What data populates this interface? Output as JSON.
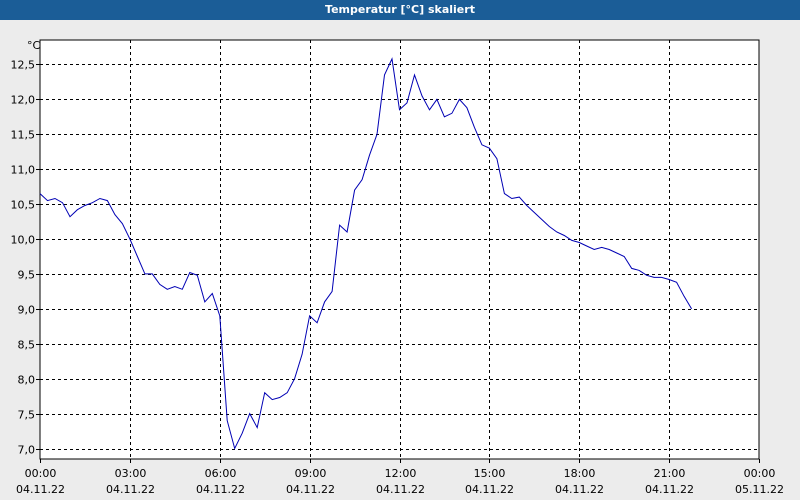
{
  "window": {
    "title": "Temperatur [°C] skaliert"
  },
  "chart_data": {
    "type": "line",
    "title": "Temperatur [°C] skaliert",
    "ylabel": "°C",
    "xlabel": "",
    "ylim": [
      6.85,
      12.85
    ],
    "xlim_hours": [
      0,
      24
    ],
    "grid": true,
    "y_ticks": [
      "7,0",
      "7,5",
      "8,0",
      "8,5",
      "9,0",
      "9,5",
      "10,0",
      "10,5",
      "11,0",
      "11,5",
      "12,0",
      "12,5"
    ],
    "x_ticks": [
      {
        "time": "00:00",
        "date": "04.11.22"
      },
      {
        "time": "03:00",
        "date": "04.11.22"
      },
      {
        "time": "06:00",
        "date": "04.11.22"
      },
      {
        "time": "09:00",
        "date": "04.11.22"
      },
      {
        "time": "12:00",
        "date": "04.11.22"
      },
      {
        "time": "15:00",
        "date": "04.11.22"
      },
      {
        "time": "18:00",
        "date": "04.11.22"
      },
      {
        "time": "21:00",
        "date": "04.11.22"
      },
      {
        "time": "00:00",
        "date": "05.11.22"
      }
    ],
    "series": [
      {
        "color": "#0000b4",
        "x_hours": [
          0.0,
          0.25,
          0.5,
          0.75,
          1.0,
          1.25,
          1.5,
          1.75,
          2.0,
          2.25,
          2.5,
          2.75,
          3.0,
          3.25,
          3.5,
          3.75,
          4.0,
          4.25,
          4.5,
          4.75,
          5.0,
          5.25,
          5.5,
          5.75,
          6.0,
          6.25,
          6.5,
          6.75,
          7.0,
          7.25,
          7.5,
          7.75,
          8.0,
          8.25,
          8.5,
          8.75,
          9.0,
          9.25,
          9.5,
          9.75,
          10.0,
          10.25,
          10.5,
          10.75,
          11.0,
          11.25,
          11.5,
          11.75,
          12.0,
          12.25,
          12.5,
          12.75,
          13.0,
          13.25,
          13.5,
          13.75,
          14.0,
          14.25,
          14.5,
          14.75,
          15.0,
          15.25,
          15.5,
          15.75,
          16.0,
          16.25,
          16.5,
          16.75,
          17.0,
          17.25,
          17.5,
          17.75,
          18.0,
          18.25,
          18.5,
          18.75,
          19.0,
          19.25,
          19.5,
          19.75,
          20.0,
          20.25,
          20.5,
          20.75,
          21.0,
          21.25,
          21.5,
          21.75,
          22.0,
          22.25,
          22.5,
          22.75,
          23.0,
          23.25,
          23.5,
          23.75
        ],
        "values": [
          10.65,
          10.55,
          10.58,
          10.52,
          10.32,
          10.42,
          10.48,
          10.52,
          10.58,
          10.55,
          10.35,
          10.22,
          10.0,
          9.75,
          9.5,
          9.5,
          9.35,
          9.28,
          9.32,
          9.28,
          9.52,
          9.48,
          9.1,
          9.22,
          8.9,
          7.4,
          7.0,
          7.22,
          7.5,
          7.3,
          7.8,
          7.7,
          7.73,
          7.8,
          8.0,
          8.35,
          8.9,
          8.8,
          9.1,
          9.25,
          10.2,
          10.1,
          10.7,
          10.85,
          11.2,
          11.5,
          12.35,
          12.58,
          11.85,
          11.95,
          12.35,
          12.05,
          11.85,
          12.0,
          11.75,
          11.8,
          12.0,
          11.88,
          11.6,
          11.35,
          11.3,
          11.15,
          10.65,
          10.58,
          10.6,
          10.48,
          10.38,
          10.28,
          10.18,
          10.1,
          10.05,
          9.98,
          9.95,
          9.9,
          9.85,
          9.88,
          9.85,
          9.8,
          9.75,
          9.58,
          9.55,
          9.48,
          9.45,
          9.45,
          9.42,
          9.38,
          9.18,
          9.0
        ]
      }
    ]
  }
}
